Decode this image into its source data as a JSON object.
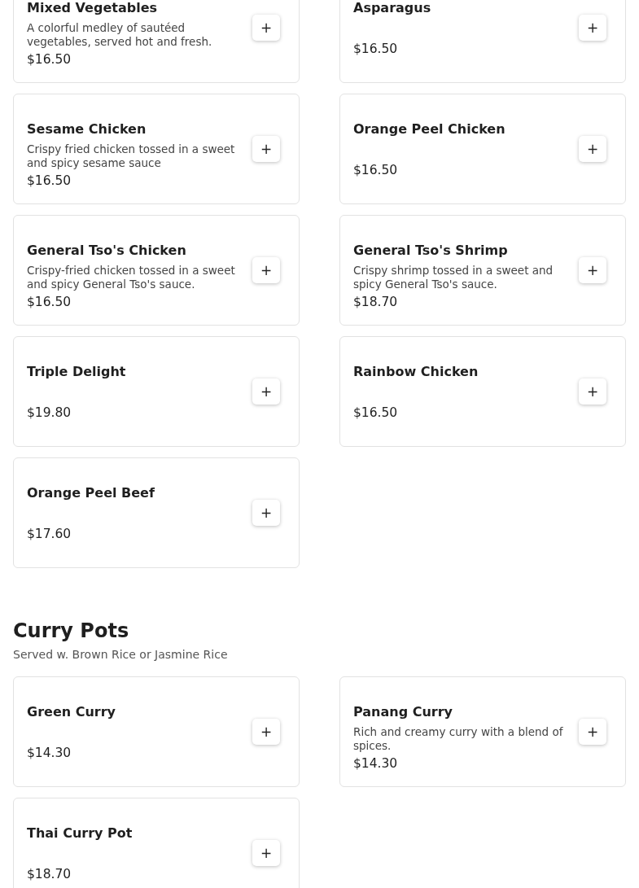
{
  "sections": [
    {
      "items": [
        {
          "name": "Mixed Vegetables",
          "description": "A colorful medley of sautéed vegetables, served hot and fresh.",
          "price": "$16.50",
          "add": "+"
        },
        {
          "name": "Asparagus",
          "price": "$16.50",
          "add": "+"
        },
        {
          "name": "Sesame Chicken",
          "description": "Crispy fried chicken tossed in a sweet and spicy sesame sauce",
          "price": "$16.50",
          "add": "+"
        },
        {
          "name": "Orange Peel Chicken",
          "price": "$16.50",
          "add": "+"
        },
        {
          "name": "General Tso's Chicken",
          "description": "Crispy-fried chicken tossed in a sweet and spicy General Tso's sauce.",
          "price": "$16.50",
          "add": "+"
        },
        {
          "name": "General Tso's Shrimp",
          "description": "Crispy shrimp tossed in a sweet and spicy General Tso's sauce.",
          "price": "$18.70",
          "add": "+"
        },
        {
          "name": "Triple Delight",
          "price": "$19.80",
          "add": "+"
        },
        {
          "name": "Rainbow Chicken",
          "price": "$16.50",
          "add": "+"
        },
        {
          "name": "Orange Peel Beef",
          "price": "$17.60",
          "add": "+"
        }
      ]
    },
    {
      "title": "Curry Pots",
      "subtitle": "Served w. Brown Rice or Jasmine Rice",
      "items": [
        {
          "name": "Green Curry",
          "price": "$14.30",
          "add": "+"
        },
        {
          "name": "Panang Curry",
          "description": "Rich and creamy curry with a blend of spices.",
          "price": "$14.30",
          "add": "+"
        },
        {
          "name": "Thai Curry Pot",
          "price": "$18.70",
          "add": "+"
        }
      ]
    }
  ]
}
